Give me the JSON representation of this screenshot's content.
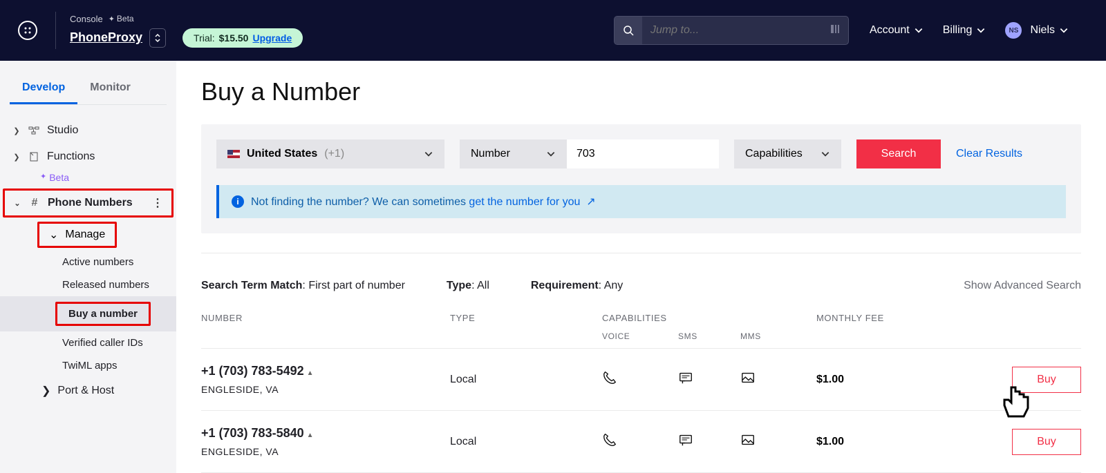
{
  "header": {
    "console": "Console",
    "beta": "Beta",
    "project": "PhoneProxy",
    "trial_label": "Trial:",
    "trial_amount": "$15.50",
    "upgrade": "Upgrade",
    "search_placeholder": "Jump to...",
    "account": "Account",
    "billing": "Billing",
    "user_initials": "NS",
    "user_name": "Niels"
  },
  "sidebar": {
    "tabs": {
      "develop": "Develop",
      "monitor": "Monitor"
    },
    "studio": "Studio",
    "functions": "Functions",
    "beta": "Beta",
    "phone_numbers": "Phone Numbers",
    "manage": "Manage",
    "active_numbers": "Active numbers",
    "released_numbers": "Released numbers",
    "buy_a_number": "Buy a number",
    "verified_caller_ids": "Verified caller IDs",
    "twiml_apps": "TwiML apps",
    "port_host": "Port & Host"
  },
  "page": {
    "title": "Buy a Number",
    "country": "United States",
    "country_code": "(+1)",
    "match_by": "Number",
    "search_value": "703",
    "capabilities": "Capabilities",
    "search_btn": "Search",
    "clear_results": "Clear Results",
    "info_prefix": "Not finding the number? We can sometimes ",
    "info_link": "get the number for you",
    "search_term_label": "Search Term Match",
    "search_term_value": "First part of number",
    "type_label": "Type",
    "type_value": "All",
    "req_label": "Requirement",
    "req_value": "Any",
    "advanced": "Show Advanced Search",
    "col_number": "NUMBER",
    "col_type": "TYPE",
    "col_capabilities": "CAPABILITIES",
    "col_fee": "MONTHLY FEE",
    "sub_voice": "VOICE",
    "sub_sms": "SMS",
    "sub_mms": "MMS",
    "rows": [
      {
        "number": "+1 (703) 783-5492",
        "location": "ENGLESIDE, VA",
        "type": "Local",
        "fee": "$1.00",
        "buy": "Buy"
      },
      {
        "number": "+1 (703) 783-5840",
        "location": "ENGLESIDE, VA",
        "type": "Local",
        "fee": "$1.00",
        "buy": "Buy"
      }
    ]
  }
}
